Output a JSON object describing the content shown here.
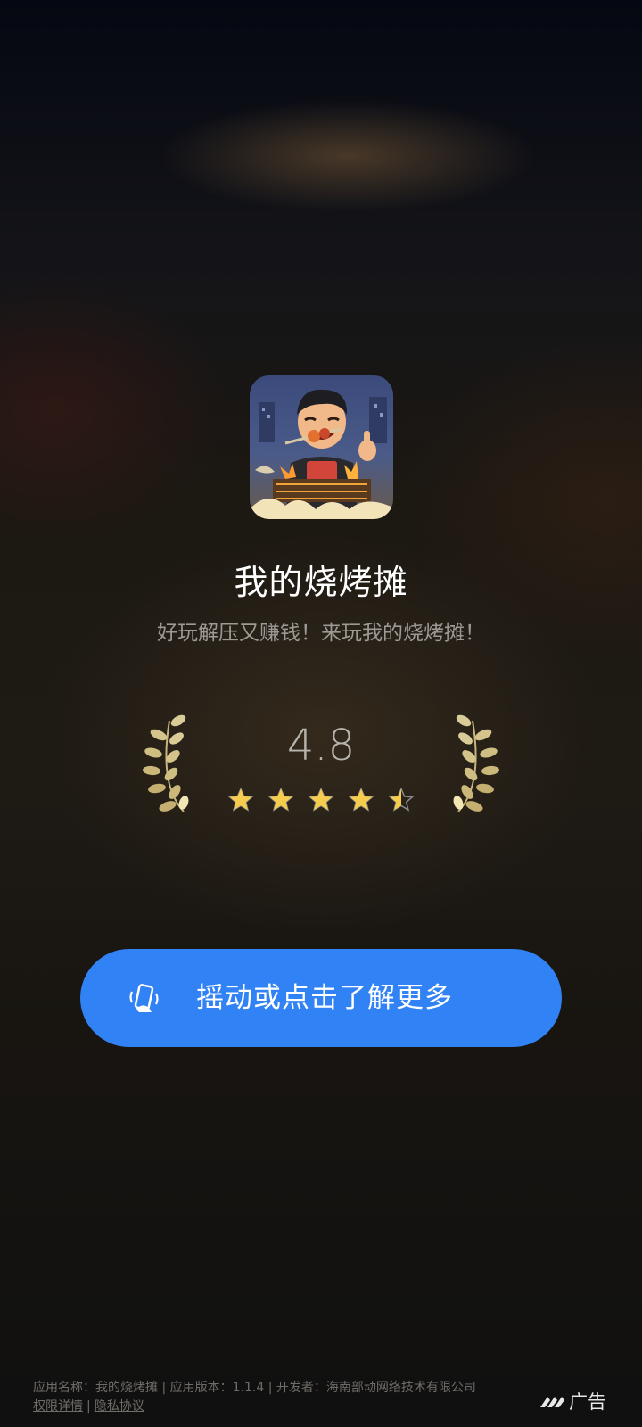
{
  "app": {
    "name": "我的烧烤摊",
    "tagline": "好玩解压又赚钱！来玩我的烧烤摊！",
    "icon": "bbq-game-app-icon"
  },
  "rating": {
    "score": "4.8",
    "stars": 4.5,
    "star_color": "#f6cc4f",
    "laurel_color": "#cfc08a"
  },
  "cta": {
    "label": "摇动或点击了解更多",
    "icon": "shake-phone-icon",
    "color": "#3182f4"
  },
  "footer": {
    "info": "应用名称：我的烧烤摊 | 应用版本：1.1.4 | 开发者：海南部动网络技术有限公司",
    "permissions_link": "权限详情",
    "divider": "|",
    "privacy_link": "隐私协议"
  },
  "ad_badge": {
    "label": "广告",
    "icon": "ad-logo-icon"
  }
}
